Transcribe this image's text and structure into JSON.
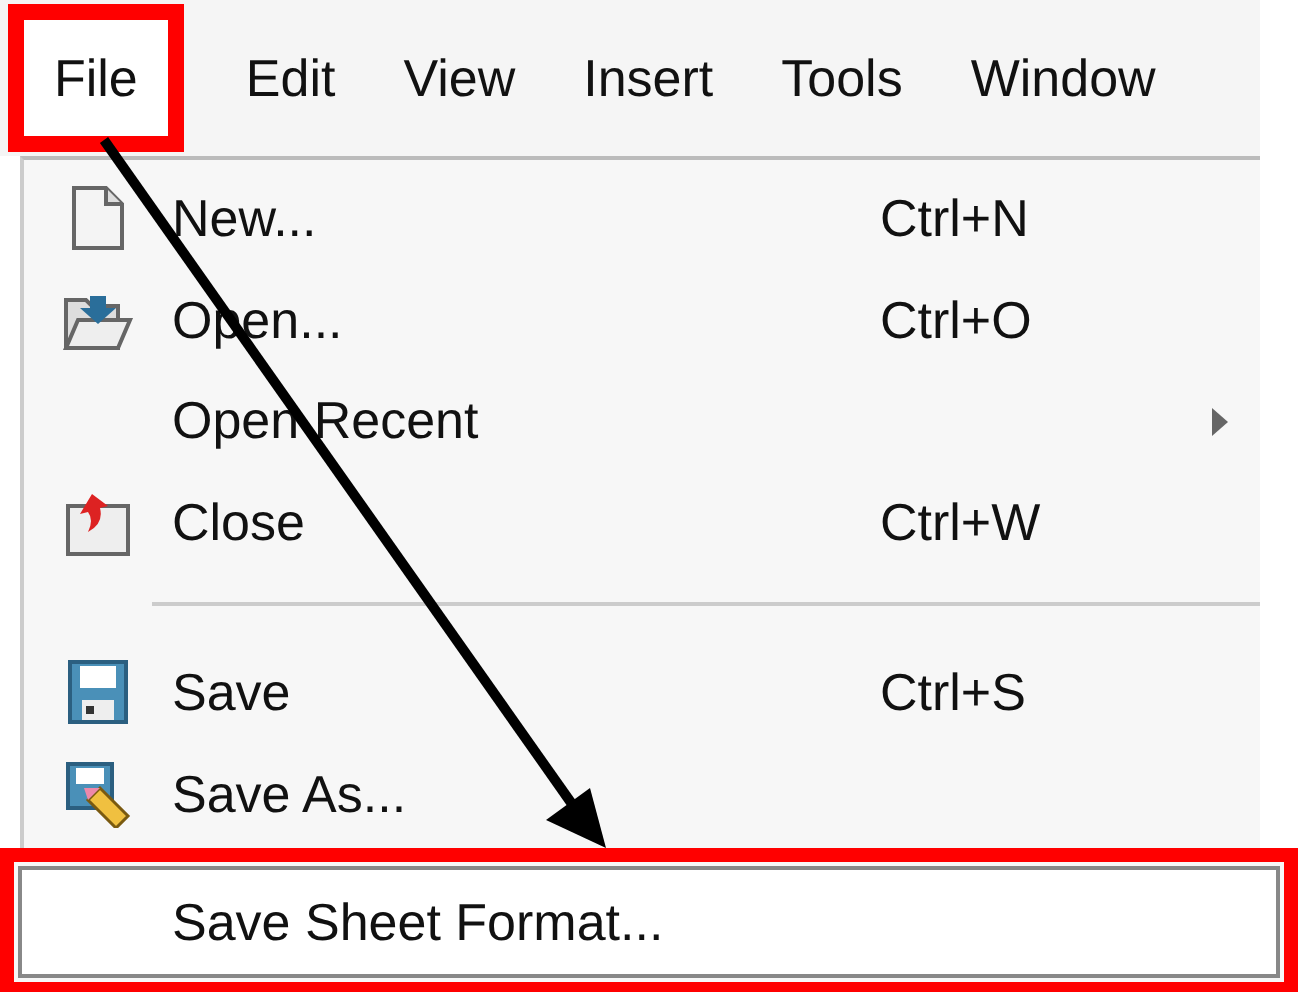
{
  "menu_bar": [
    {
      "label": "File",
      "highlighted": true
    },
    {
      "label": "Edit",
      "highlighted": false
    },
    {
      "label": "View",
      "highlighted": false
    },
    {
      "label": "Insert",
      "highlighted": false
    },
    {
      "label": "Tools",
      "highlighted": false
    },
    {
      "label": "Window",
      "highlighted": false
    }
  ],
  "file_menu": [
    {
      "kind": "item",
      "label": "New...",
      "shortcut": "Ctrl+N",
      "submenu": false,
      "highlighted": false
    },
    {
      "kind": "item",
      "label": "Open...",
      "shortcut": "Ctrl+O",
      "submenu": false,
      "highlighted": false
    },
    {
      "kind": "item",
      "label": "Open Recent",
      "submenu": true,
      "highlighted": false
    },
    {
      "kind": "item",
      "label": "Close",
      "shortcut": "Ctrl+W",
      "submenu": false,
      "highlighted": false
    },
    {
      "kind": "separator"
    },
    {
      "kind": "item",
      "label": "Save",
      "shortcut": "Ctrl+S",
      "submenu": false,
      "highlighted": false
    },
    {
      "kind": "item",
      "label": "Save As...",
      "submenu": false,
      "highlighted": false
    },
    {
      "kind": "item",
      "label": "Save Sheet Format...",
      "submenu": false,
      "highlighted": true
    }
  ],
  "annotation": {
    "kind": "arrow"
  }
}
